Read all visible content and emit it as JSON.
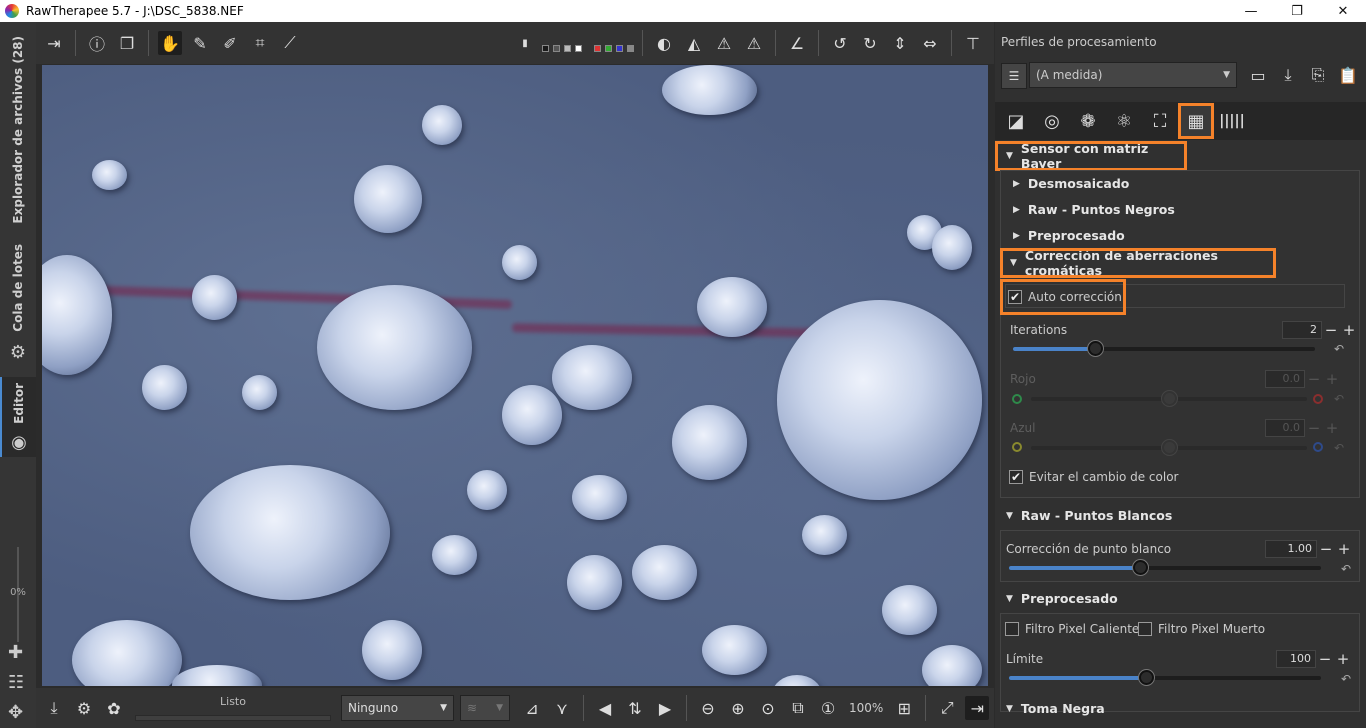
{
  "window": {
    "title": "RawTherapee 5.7 - J:\\DSC_5838.NEF",
    "minimize": "—",
    "restore": "❐",
    "close": "✕"
  },
  "left_tabs": {
    "file_browser": "Explorador de archivos (28)",
    "queue": "Cola de lotes",
    "editor": "Editor",
    "zoom_percent": "0%"
  },
  "toolbar": {
    "swatch_colors": [
      "#1a1a1a",
      "#555555",
      "#bbbbbb",
      "#ffffff",
      "#d33",
      "#3a3",
      "#33c",
      "#888"
    ]
  },
  "bottom": {
    "status": "Listo",
    "combo_value": "Ninguno",
    "zoom": "100%"
  },
  "right": {
    "profiles_label": "Perfiles de procesamiento",
    "profile_value": "(A medida)",
    "sections": {
      "bayer": "Sensor con matriz Bayer",
      "demosaic": "Desmosaicado",
      "raw_black": "Raw - Puntos Negros",
      "preprocess1": "Preprocesado",
      "ca": "Corrección de aberraciones cromáticas",
      "raw_white": "Raw - Puntos Blancos",
      "preprocess2": "Preprocesado",
      "dark": "Toma Negra"
    },
    "ca": {
      "auto_label": "Auto corrección",
      "iterations_label": "Iterations",
      "iterations_value": "2",
      "iterations_fraction": 0.27,
      "red_label": "Rojo",
      "red_value": "0.0",
      "blue_label": "Azul",
      "blue_value": "0.0",
      "avoid_label": "Evitar el cambio de color"
    },
    "white": {
      "label": "Corrección de punto blanco",
      "value": "1.00",
      "fraction": 0.42
    },
    "pre": {
      "hot_label": "Filtro Pixel Caliente",
      "dead_label": "Filtro Pixel Muerto",
      "limit_label": "Límite",
      "limit_value": "100",
      "limit_fraction": 0.44
    },
    "highlight_color": "#f5822a",
    "slider_color": "#4a83c9"
  }
}
